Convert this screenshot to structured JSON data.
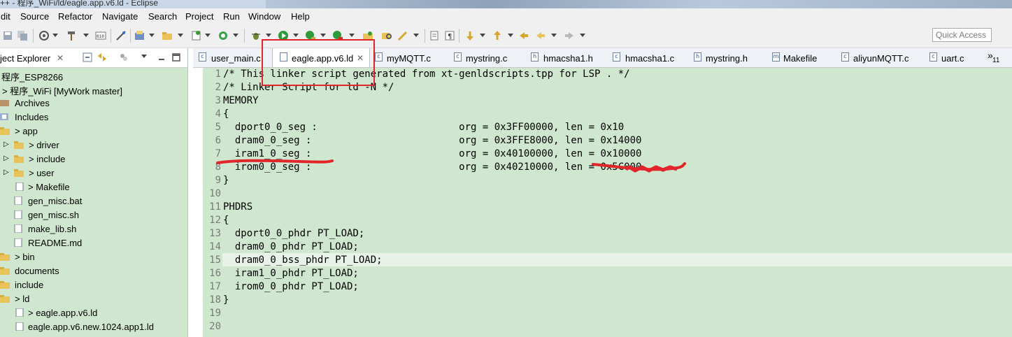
{
  "window": {
    "title": "++ - 程序_WiFi/ld/eagle.app.v6.ld - Eclipse"
  },
  "menu": [
    "dit",
    "Source",
    "Refactor",
    "Navigate",
    "Search",
    "Project",
    "Run",
    "Window",
    "Help"
  ],
  "toolbar": {
    "quick_access_placeholder": "Quick Access",
    "icons": [
      "save-icon",
      "save-all-icon",
      "build-icon",
      "hammer-icon",
      "new-c-file-icon",
      "binary-icon",
      "debug-icon",
      "new-project-icon",
      "new-folder-icon",
      "new-class-icon",
      "refresh-icon",
      "debug-bug-icon",
      "run-icon",
      "run-ext-icon",
      "profile-icon",
      "open-type-icon",
      "search-icon",
      "pen-icon",
      "toggle-mark-icon",
      "show-whitespace-icon",
      "next-annotation-icon",
      "prev-annotation-icon",
      "back-icon",
      "forward-icon"
    ]
  },
  "explorer": {
    "title": "ject Explorer",
    "items": [
      {
        "label": "程序_ESP8266",
        "icon": "project-icon"
      },
      {
        "label": "> 程序_WiFi  [MyWork master]",
        "icon": "project-icon"
      },
      {
        "label": "Archives",
        "icon": "archive-icon"
      },
      {
        "label": "Includes",
        "icon": "includes-icon"
      },
      {
        "label": "> app",
        "icon": "folder-icon"
      },
      {
        "label": "> driver",
        "icon": "folder-icon"
      },
      {
        "label": "> include",
        "icon": "folder-icon"
      },
      {
        "label": "> user",
        "icon": "folder-icon"
      },
      {
        "label": "> Makefile",
        "icon": "file-icon"
      },
      {
        "label": "gen_misc.bat",
        "icon": "file-icon"
      },
      {
        "label": "gen_misc.sh",
        "icon": "file-icon"
      },
      {
        "label": "make_lib.sh",
        "icon": "file-icon"
      },
      {
        "label": "README.md",
        "icon": "file-icon"
      },
      {
        "label": "> bin",
        "icon": "folder-icon"
      },
      {
        "label": "documents",
        "icon": "folder-icon"
      },
      {
        "label": "include",
        "icon": "folder-icon"
      },
      {
        "label": "> ld",
        "icon": "folder-icon"
      },
      {
        "label": "> eagle.app.v6.ld",
        "icon": "file-icon"
      },
      {
        "label": "eagle.app.v6.new.1024.app1.ld",
        "icon": "file-icon"
      }
    ]
  },
  "tabs": [
    {
      "label": "user_main.c",
      "icon": "c"
    },
    {
      "label": "eagle.app.v6.ld",
      "icon": "",
      "active": true
    },
    {
      "label": "myMQTT.c",
      "icon": "c"
    },
    {
      "label": "mystring.c",
      "icon": "c"
    },
    {
      "label": "hmacsha1.h",
      "icon": "h"
    },
    {
      "label": "hmacsha1.c",
      "icon": "c"
    },
    {
      "label": "mystring.h",
      "icon": "h"
    },
    {
      "label": "Makefile",
      "icon": "m"
    },
    {
      "label": "aliyunMQTT.c",
      "icon": "c"
    },
    {
      "label": "uart.c",
      "icon": "c"
    }
  ],
  "tab_overflow": {
    "chevron": "»",
    "count": "11"
  },
  "editor": {
    "lines": [
      {
        "n": "1",
        "text": "/* This linker script generated from xt-genldscripts.tpp for LSP . */"
      },
      {
        "n": "2",
        "text": "/* Linker Script for ld -N */"
      },
      {
        "n": "3",
        "text": "MEMORY"
      },
      {
        "n": "4",
        "text": "{"
      },
      {
        "n": "5",
        "text": "  dport0_0_seg :                        org = 0x3FF00000, len = 0x10"
      },
      {
        "n": "6",
        "text": "  dram0_0_seg :                         org = 0x3FFE8000, len = 0x14000"
      },
      {
        "n": "7",
        "text": "  iram1_0_seg :                         org = 0x40100000, len = 0x10000"
      },
      {
        "n": "8",
        "text": "  irom0_0_seg :                         org = 0x40210000, len = 0x5C000"
      },
      {
        "n": "9",
        "text": "}"
      },
      {
        "n": "10",
        "text": ""
      },
      {
        "n": "11",
        "text": "PHDRS"
      },
      {
        "n": "12",
        "text": "{"
      },
      {
        "n": "13",
        "text": "  dport0_0_phdr PT_LOAD;"
      },
      {
        "n": "14",
        "text": "  dram0_0_phdr PT_LOAD;"
      },
      {
        "n": "15",
        "text": "  dram0_0_bss_phdr PT_LOAD;"
      },
      {
        "n": "16",
        "text": "  iram1_0_phdr PT_LOAD;"
      },
      {
        "n": "17",
        "text": "  irom0_0_phdr PT_LOAD;"
      },
      {
        "n": "18",
        "text": "}"
      },
      {
        "n": "19",
        "text": ""
      },
      {
        "n": "20",
        "text": ""
      }
    ],
    "current_line": "15"
  },
  "colors": {
    "editor_bg": "#cfe6cf",
    "current_line_bg": "#e9f2e9",
    "annotation_red": "#e2252a",
    "tab_bar_bg": "#eef2f6"
  }
}
